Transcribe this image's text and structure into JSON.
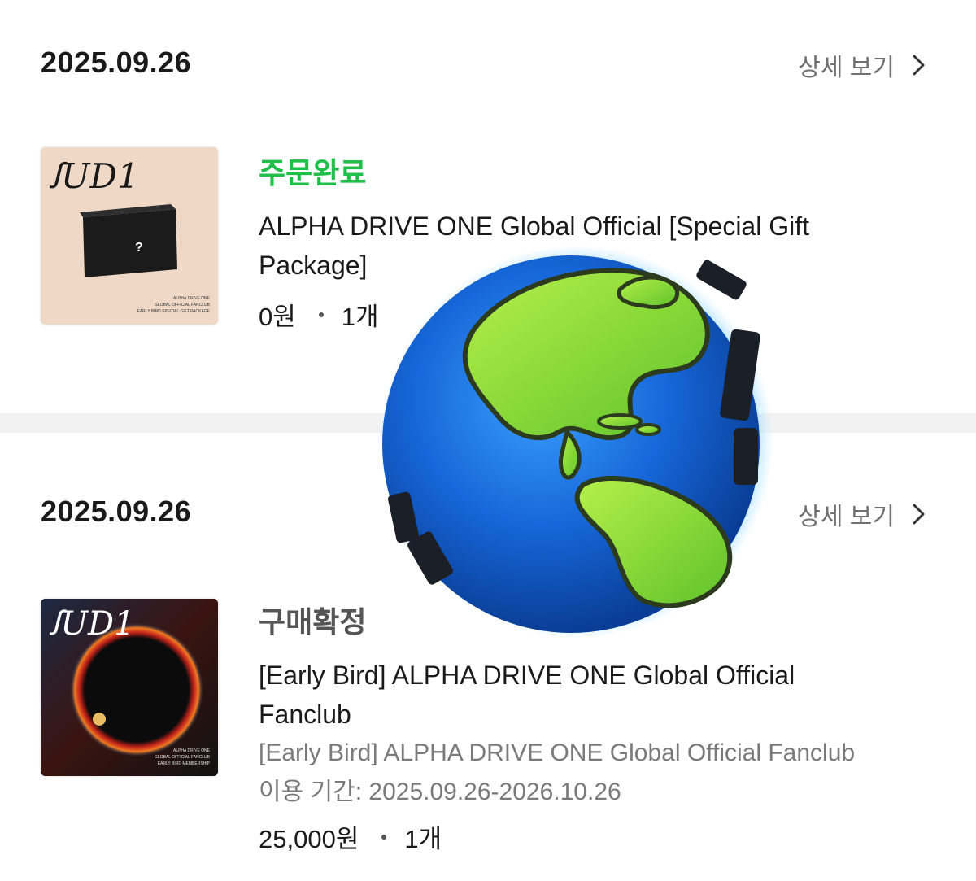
{
  "orders": [
    {
      "date": "2025.09.26",
      "detail_label": "상세 보기",
      "status": "주문완료",
      "title_line1": "ALPHA DRIVE ONE Global Official [Special Gift",
      "title_line2": "Package]",
      "price": "0원",
      "quantity": "1개",
      "thumb": {
        "logo": "ꭍUD1",
        "box_mark": "?",
        "caption_line1": "ALPHA DRIVE ONE",
        "caption_line2": "GLOBAL OFFICIAL FANCLUB",
        "caption_line3": "EARLY BIRD SPECIAL GIFT PACKAGE"
      }
    },
    {
      "date": "2025.09.26",
      "detail_label": "상세 보기",
      "status": "구매확정",
      "title_line1": "[Early Bird] ALPHA DRIVE ONE Global Official",
      "title_line2": "Fanclub",
      "option": "[Early Bird] ALPHA DRIVE ONE Global Official Fanclub",
      "period": "이용 기간: 2025.09.26-2026.10.26",
      "price": "25,000원",
      "quantity": "1개",
      "thumb": {
        "logo": "ꭍUD1",
        "caption_line1": "ALPHA DRIVE ONE",
        "caption_line2": "GLOBAL OFFICIAL FANCLUB",
        "caption_line3": "EARLY BIRD MEMBERSHIP"
      }
    }
  ],
  "colors": {
    "status_complete": "#1fbf4a",
    "status_confirmed": "#555555",
    "divider": "#f2f2f2"
  },
  "icons": [
    "chevron-right-icon",
    "globe-sticker-icon"
  ]
}
